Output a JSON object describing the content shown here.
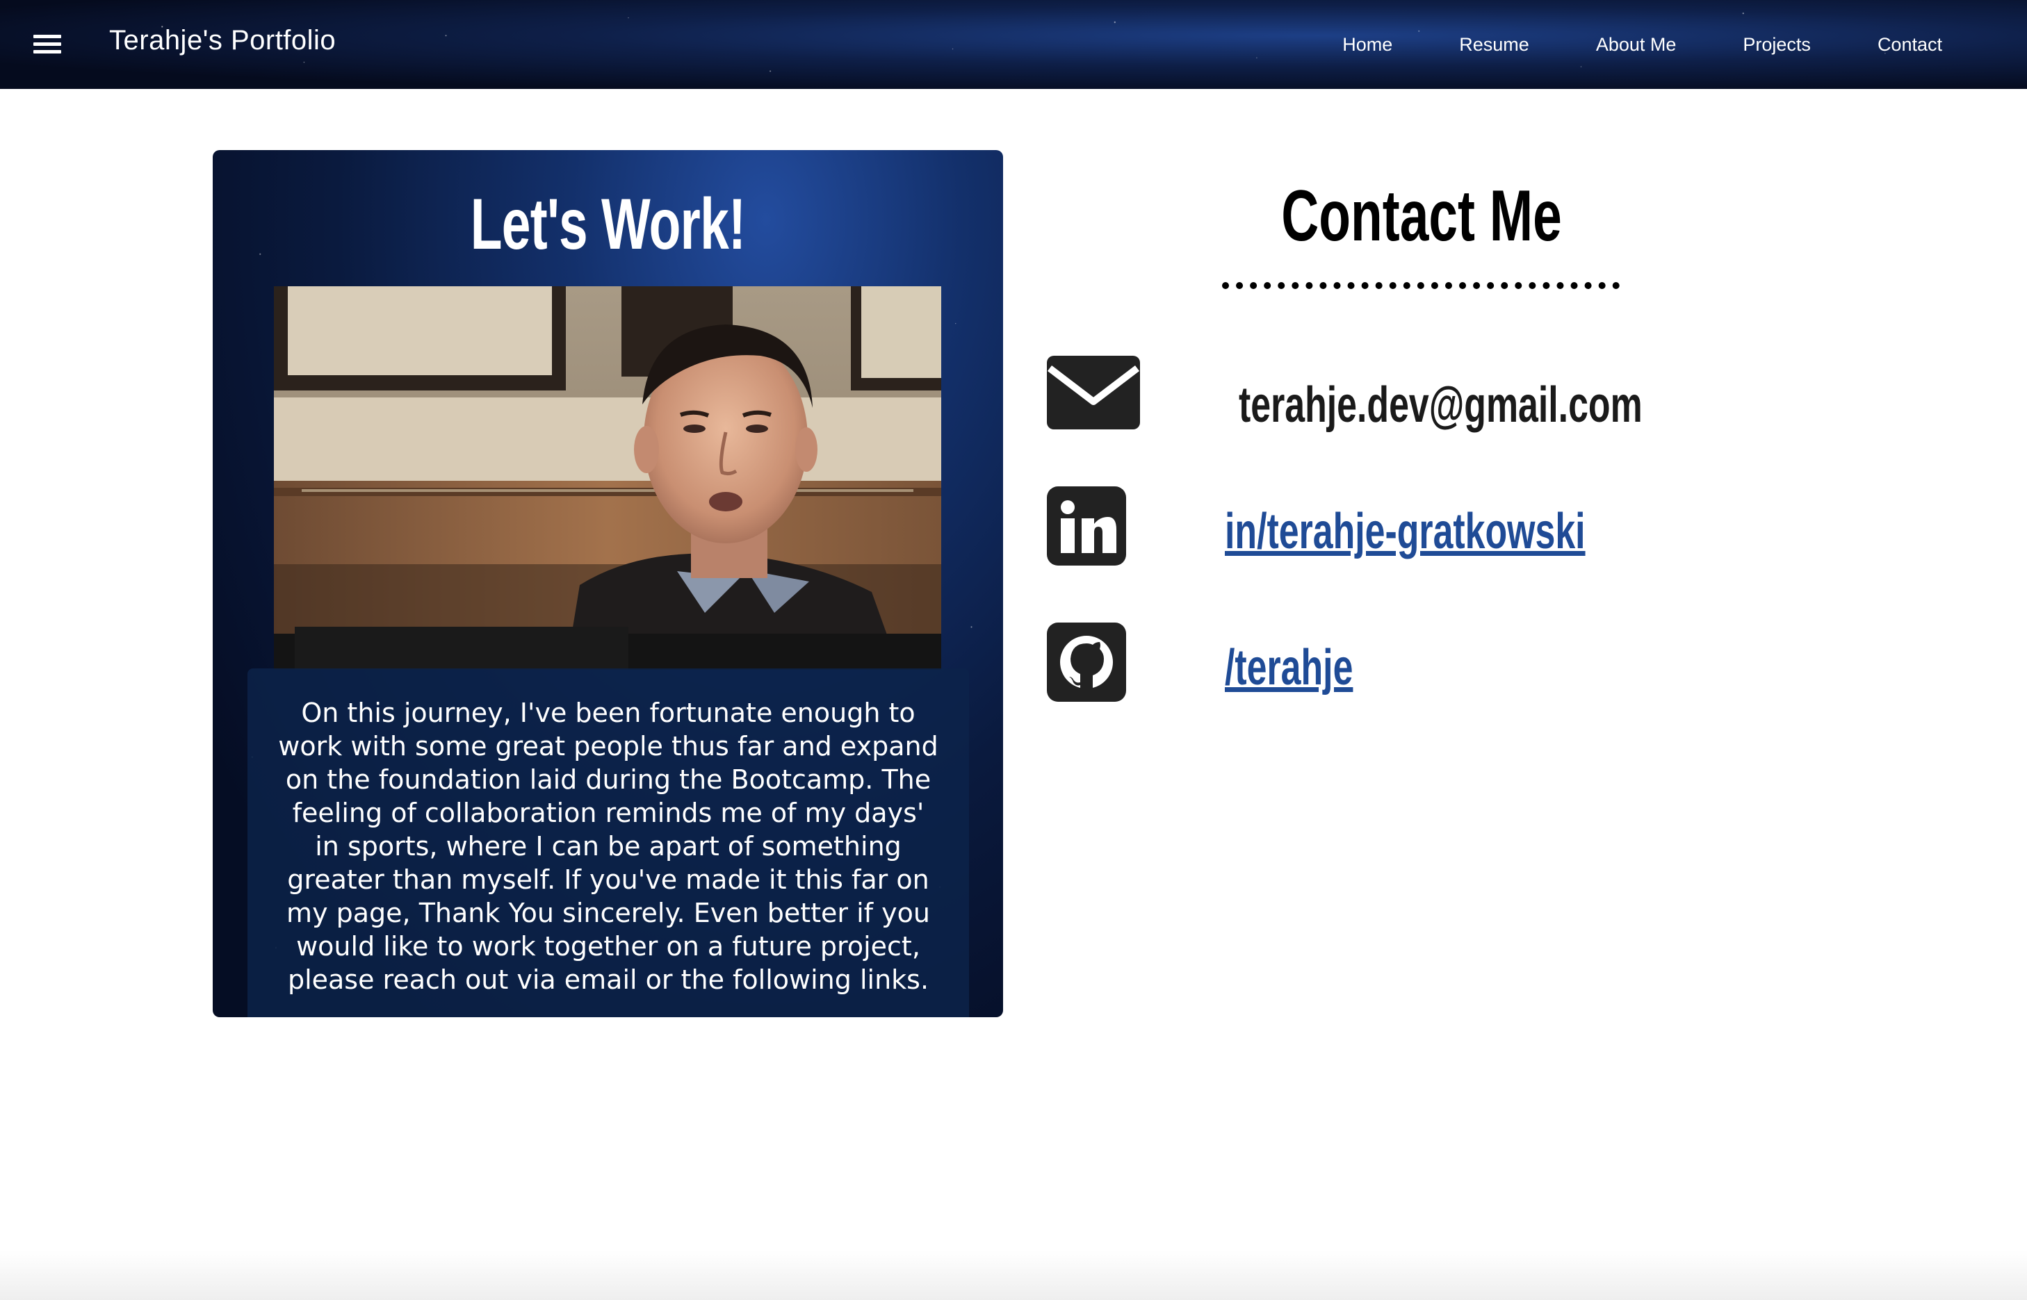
{
  "nav": {
    "brand": "Terahje's Portfolio",
    "links": [
      "Home",
      "Resume",
      "About Me",
      "Projects",
      "Contact"
    ]
  },
  "card": {
    "title": "Let's Work!",
    "body": "On this journey, I've been fortunate enough to work with some great people thus far and expand on the foundation laid during the Bootcamp. The feeling of collaboration reminds me of my days' in sports, where I can be apart of something greater than myself. If you've made it this far on my page, Thank You sincerely. Even better if you would like to work together on a future project, please reach out via email or the following links."
  },
  "contact": {
    "title": "Contact Me",
    "email": "terahje.dev@gmail.com",
    "linkedin": "in/terahje-gratkowski",
    "github": "/terahje"
  },
  "colors": {
    "link": "#1f4b96",
    "nav_bg": "#050b1e",
    "card_bg": "#0a1a3e",
    "icon": "#222222"
  },
  "icons": {
    "menu": "hamburger-menu-icon",
    "email": "envelope-icon",
    "linkedin": "linkedin-icon",
    "github": "github-icon"
  }
}
